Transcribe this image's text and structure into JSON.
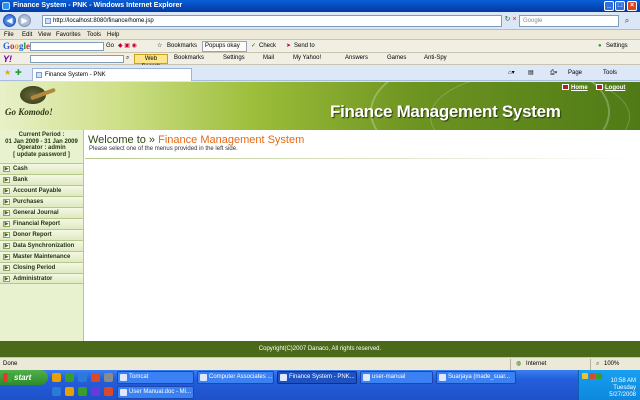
{
  "window": {
    "title": "Finance System - PNK - Windows Internet Explorer",
    "min": "_",
    "max": "□",
    "close": "×"
  },
  "address": {
    "url": "http://localhost:8080/finance/home.jsp",
    "search_placeholder": "Google"
  },
  "menubar": [
    "File",
    "Edit",
    "View",
    "Favorites",
    "Tools",
    "Help"
  ],
  "google_toolbar": {
    "logo": "Google",
    "go": "Go",
    "bookmarks": "Bookmarks",
    "popups": "Popups okay",
    "check": "Check",
    "sendto": "Send to",
    "settings": "Settings"
  },
  "yahoo_toolbar": {
    "logo": "Y!",
    "web_search": "Web Search",
    "bookmarks": "Bookmarks",
    "settings": "Settings",
    "mail": "Mail",
    "my_yahoo": "My Yahoo!",
    "answers": "Answers",
    "games": "Games",
    "antispy": "Anti-Spy"
  },
  "tab": {
    "label": "Finance System - PNK",
    "page_cmd": "Page",
    "tools_cmd": "Tools"
  },
  "app": {
    "logo_text": "Go Komodo!",
    "title": "Finance Management System",
    "home_link": "Home",
    "logout_link": "Logout",
    "period": {
      "label": "Current Period :",
      "range": "01 Jan 2009 - 31 Jan 2009",
      "operator": "Operator : admin",
      "update_password": "[ update password ]"
    },
    "menu": [
      "Cash",
      "Bank",
      "Account Payable",
      "Purchases",
      "General Journal",
      "Financial Report",
      "Donor Report",
      "Data Synchronization",
      "Master Maintenance",
      "Closing Period",
      "Administrator"
    ],
    "welcome_prefix": "Welcome to »",
    "welcome_system": "Finance Management System",
    "hint": "Please select one of the menus provided in the left side.",
    "footer": "Copyright(C)2007 Danaco, All rights reserved."
  },
  "statusbar": {
    "done": "Done",
    "zone": "Internet",
    "zoom": "100%"
  },
  "taskbar": {
    "start": "start",
    "tasks_row1": [
      "Tomcat",
      "Computer Associates ...",
      "Finance System - PNK...",
      "user-manual",
      "Suarjaya (made_suar..."
    ],
    "tasks_row2": [
      "User Manual.doc - Mi..."
    ],
    "time": "10:58 AM",
    "day": "Tuesday",
    "date": "5/27/2008"
  }
}
